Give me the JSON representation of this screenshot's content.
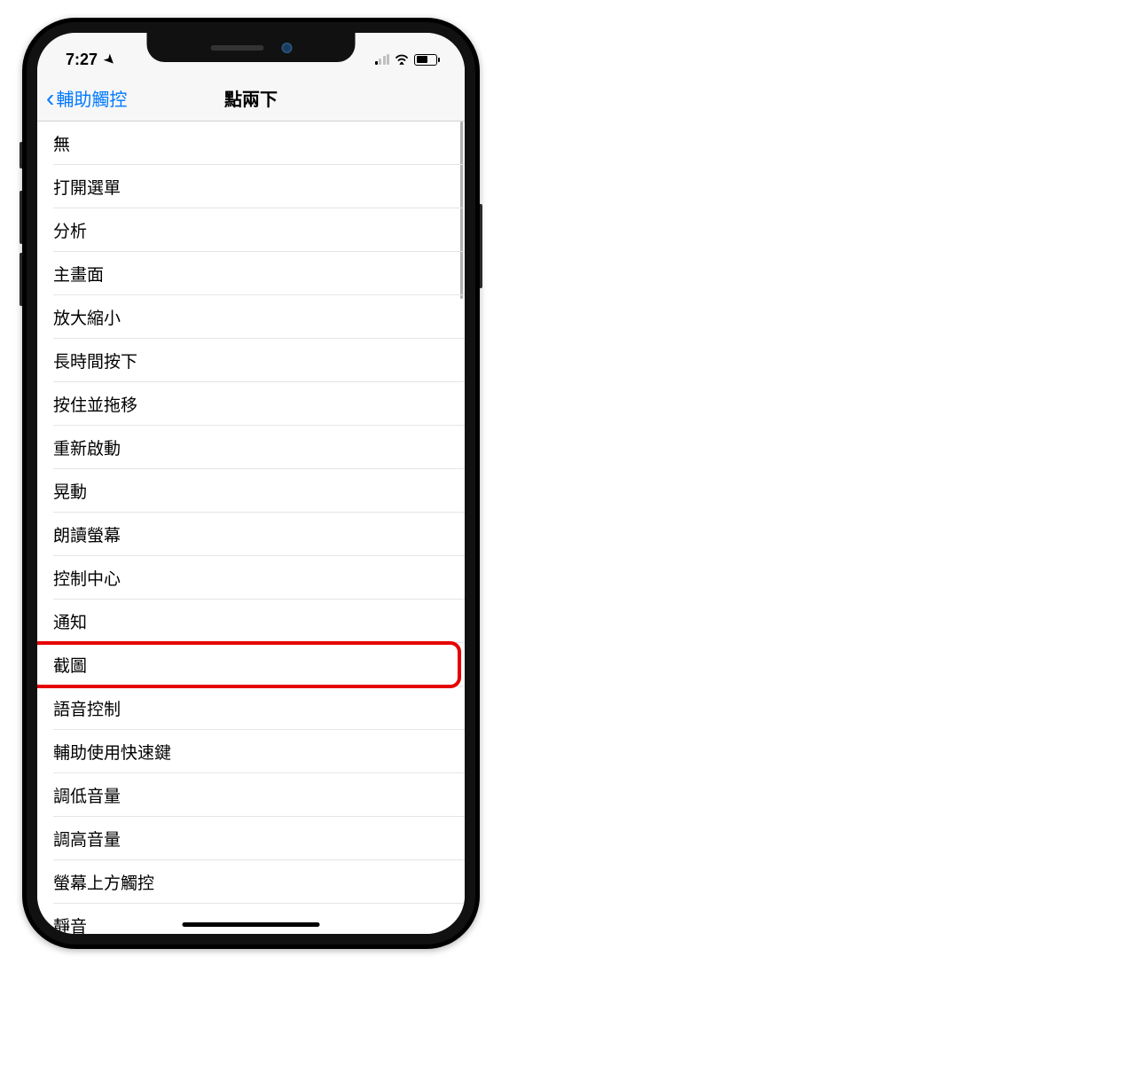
{
  "status_bar": {
    "time": "7:27",
    "signal_bars_active": 1,
    "signal_bars_total": 4,
    "wifi_active": true,
    "battery_percent": 60
  },
  "nav": {
    "back_label": "輔助觸控",
    "title": "點兩下"
  },
  "highlighted_index": 12,
  "list": {
    "items": [
      {
        "label": "無"
      },
      {
        "label": "打開選單"
      },
      {
        "label": "分析"
      },
      {
        "label": "主畫面"
      },
      {
        "label": "放大縮小"
      },
      {
        "label": "長時間按下"
      },
      {
        "label": "按住並拖移"
      },
      {
        "label": "重新啟動"
      },
      {
        "label": "晃動"
      },
      {
        "label": "朗讀螢幕"
      },
      {
        "label": "控制中心"
      },
      {
        "label": "通知"
      },
      {
        "label": "截圖"
      },
      {
        "label": "語音控制"
      },
      {
        "label": "輔助使用快速鍵"
      },
      {
        "label": "調低音量"
      },
      {
        "label": "調高音量"
      },
      {
        "label": "螢幕上方觸控"
      },
      {
        "label": "靜音"
      }
    ]
  }
}
